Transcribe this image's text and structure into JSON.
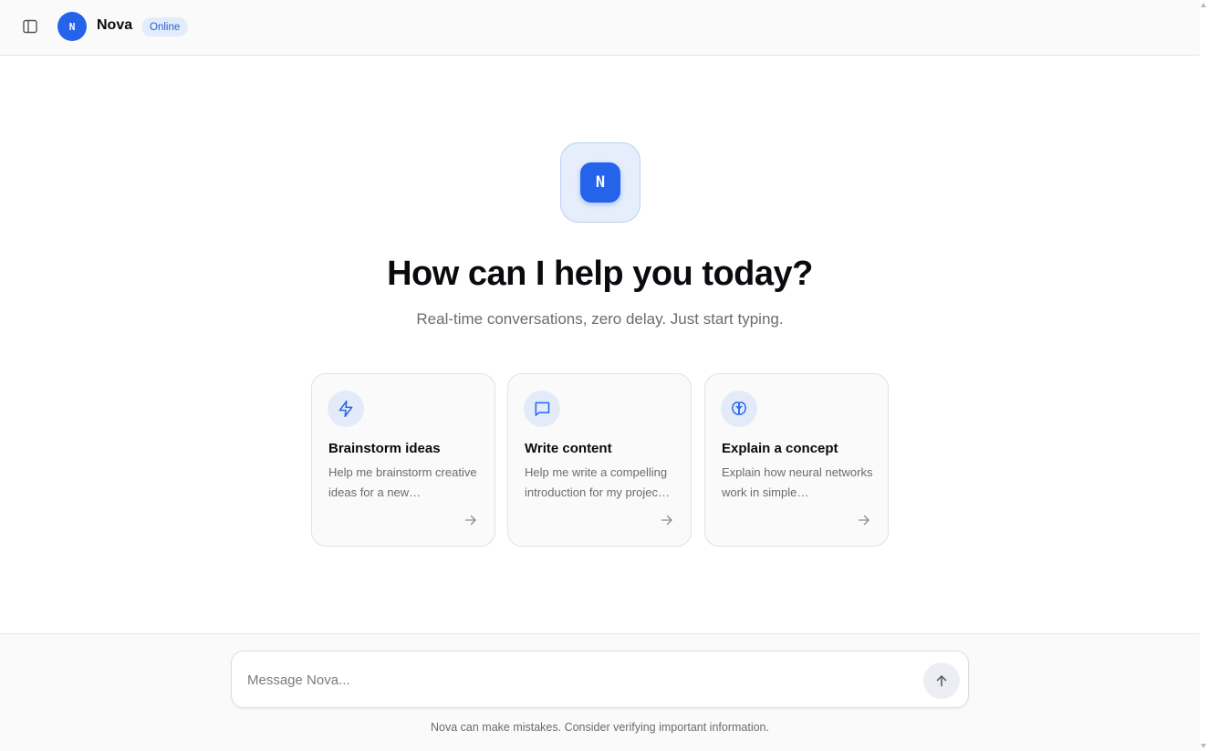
{
  "header": {
    "logo_letter": "N",
    "app_name": "Nova",
    "status": "Online"
  },
  "hero": {
    "logo_letter": "N",
    "title": "How can I help you today?",
    "subtitle": "Real-time conversations, zero delay. Just start typing."
  },
  "cards": [
    {
      "icon": "lightning-icon",
      "title": "Brainstorm ideas",
      "description": "Help me brainstorm creative ideas for a new…"
    },
    {
      "icon": "message-square-icon",
      "title": "Write content",
      "description": "Help me write a compelling introduction for my projec…"
    },
    {
      "icon": "brain-icon",
      "title": "Explain a concept",
      "description": "Explain how neural networks work in simple…"
    }
  ],
  "composer": {
    "placeholder": "Message Nova...",
    "value": ""
  },
  "footer": {
    "disclaimer": "Nova can make mistakes. Consider verifying important information."
  },
  "colors": {
    "accent": "#2563eb",
    "badge_bg": "#e3ecfb",
    "badge_text": "#2a5fc8"
  }
}
